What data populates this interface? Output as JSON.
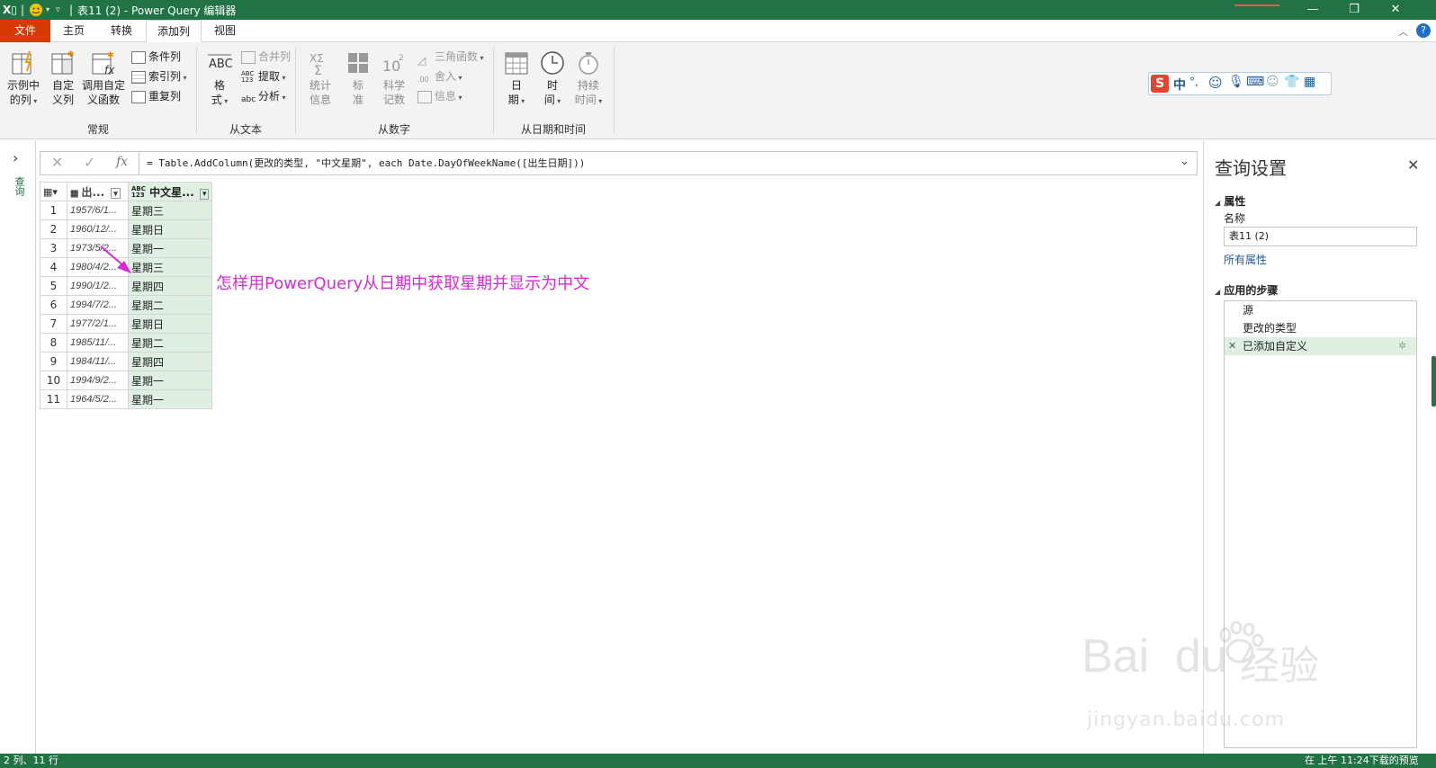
{
  "titlebar": {
    "title": "表11 (2) - Power Query 编辑器",
    "app_icon": "excel-icon"
  },
  "tabs": [
    {
      "label": "文件"
    },
    {
      "label": "主页"
    },
    {
      "label": "转换"
    },
    {
      "label": "添加列"
    },
    {
      "label": "视图"
    }
  ],
  "ribbon": {
    "general": {
      "label": "常规",
      "example_col": "示例中\n的列",
      "custom_col": "自定\n义列",
      "invoke_func": "调用自定\n义函数",
      "conditional_col": "条件列",
      "index_col": "索引列",
      "duplicate_col": "重复列"
    },
    "from_text": {
      "label": "从文本",
      "format": "格\n式",
      "merge": "合并列",
      "extract": "提取",
      "parse": "分析"
    },
    "from_number": {
      "label": "从数字",
      "stats": "统计\n信息",
      "standard": "标\n准",
      "scientific": "科学\n记数",
      "trig": "三角函数",
      "rounding": "舍入",
      "info": "信息"
    },
    "from_datetime": {
      "label": "从日期和时间",
      "date": "日\n期",
      "time": "时\n间",
      "duration": "持续\n时间"
    }
  },
  "ime": {
    "lang": "中",
    "punct": "°,"
  },
  "formula": {
    "text": "= Table.AddColumn(更改的类型, \"中文星期\", each Date.DayOfWeekName([出生日期]))",
    "fx": "fx"
  },
  "leftnav": {
    "label": "查询"
  },
  "grid": {
    "col1_header": "出...",
    "col2_header": "中文星...",
    "type_badge": "ABC\n123",
    "rows": [
      {
        "n": "1",
        "date": "1957/6/1...",
        "week": "星期三"
      },
      {
        "n": "2",
        "date": "1960/12/...",
        "week": "星期日"
      },
      {
        "n": "3",
        "date": "1973/5/2...",
        "week": "星期一"
      },
      {
        "n": "4",
        "date": "1980/4/2...",
        "week": "星期三"
      },
      {
        "n": "5",
        "date": "1990/1/2...",
        "week": "星期四"
      },
      {
        "n": "6",
        "date": "1994/7/2...",
        "week": "星期二"
      },
      {
        "n": "7",
        "date": "1977/2/1...",
        "week": "星期日"
      },
      {
        "n": "8",
        "date": "1985/11/...",
        "week": "星期二"
      },
      {
        "n": "9",
        "date": "1984/11/...",
        "week": "星期四"
      },
      {
        "n": "10",
        "date": "1994/9/2...",
        "week": "星期一"
      },
      {
        "n": "11",
        "date": "1964/5/2...",
        "week": "星期一"
      }
    ]
  },
  "annotation": "怎样用PowerQuery从日期中获取星期并显示为中文",
  "query_settings": {
    "title": "查询设置",
    "properties": "属性",
    "name_label": "名称",
    "name_value": "表11 (2)",
    "all_props": "所有属性",
    "steps_title": "应用的步骤",
    "steps": [
      "源",
      "更改的类型",
      "已添加自定义"
    ]
  },
  "status": {
    "left": "2 列、11 行",
    "right": "在 上午 11:24下载的预览"
  },
  "watermark": {
    "brand": "Bai",
    "brand2": "du",
    "cn": "经验",
    "url": "jingyan.baidu.com"
  },
  "colors": {
    "excel_green": "#217346",
    "file_tab": "#d83b01",
    "accent_green_light": "#dff0e3",
    "annotation": "#d62bd6"
  }
}
